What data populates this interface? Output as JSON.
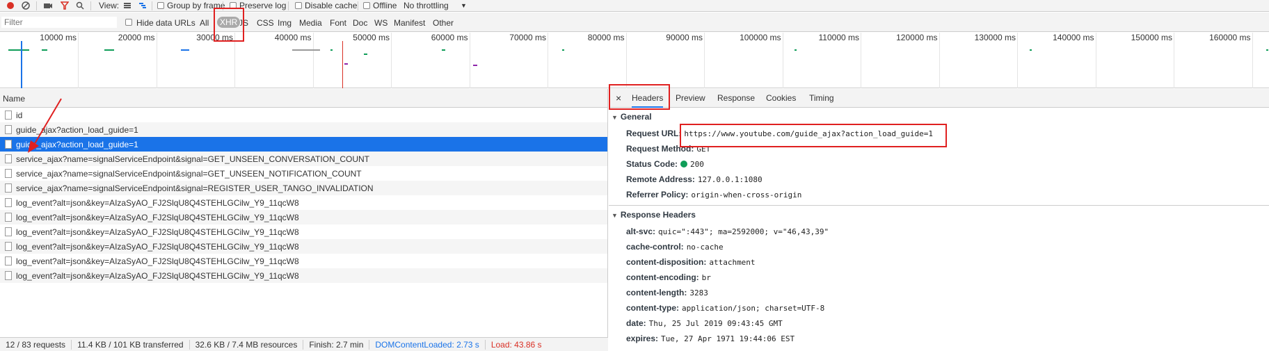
{
  "toolbar": {
    "view_label": "View:",
    "group_by_frame": "Group by frame",
    "preserve_log": "Preserve log",
    "disable_cache": "Disable cache",
    "offline": "Offline",
    "throttling": "No throttling"
  },
  "filterbar": {
    "placeholder": "Filter",
    "hide_data_urls": "Hide data URLs",
    "types": [
      "All",
      "XHR",
      "JS",
      "CSS",
      "Img",
      "Media",
      "Font",
      "Doc",
      "WS",
      "Manifest",
      "Other"
    ],
    "active_type": "XHR"
  },
  "overview": {
    "ticks": [
      "10000 ms",
      "20000 ms",
      "30000 ms",
      "40000 ms",
      "50000 ms",
      "60000 ms",
      "70000 ms",
      "80000 ms",
      "90000 ms",
      "100000 ms",
      "110000 ms",
      "120000 ms",
      "130000 ms",
      "140000 ms",
      "150000 ms",
      "160000 ms"
    ]
  },
  "list": {
    "header": "Name",
    "rows": [
      "id",
      "guide_ajax?action_load_guide=1",
      "guide_ajax?action_load_guide=1",
      "service_ajax?name=signalServiceEndpoint&signal=GET_UNSEEN_CONVERSATION_COUNT",
      "service_ajax?name=signalServiceEndpoint&signal=GET_UNSEEN_NOTIFICATION_COUNT",
      "service_ajax?name=signalServiceEndpoint&signal=REGISTER_USER_TANGO_INVALIDATION",
      "log_event?alt=json&key=AIzaSyAO_FJ2SlqU8Q4STEHLGCilw_Y9_11qcW8",
      "log_event?alt=json&key=AIzaSyAO_FJ2SlqU8Q4STEHLGCilw_Y9_11qcW8",
      "log_event?alt=json&key=AIzaSyAO_FJ2SlqU8Q4STEHLGCilw_Y9_11qcW8",
      "log_event?alt=json&key=AIzaSyAO_FJ2SlqU8Q4STEHLGCilw_Y9_11qcW8",
      "log_event?alt=json&key=AIzaSyAO_FJ2SlqU8Q4STEHLGCilw_Y9_11qcW8",
      "log_event?alt=json&key=AIzaSyAO_FJ2SlqU8Q4STEHLGCilw_Y9_11qcW8"
    ],
    "selected_row": 2
  },
  "status": {
    "requests": "12 / 83 requests",
    "transferred": "11.4 KB / 101 KB transferred",
    "resources": "32.6 KB / 7.4 MB resources",
    "finish": "Finish: 2.7 min",
    "dom_content_loaded": "DOMContentLoaded: 2.73 s",
    "load": "Load: 43.86 s"
  },
  "detail": {
    "tabs": [
      "Headers",
      "Preview",
      "Response",
      "Cookies",
      "Timing"
    ],
    "active_tab": "Headers",
    "general_title": "General",
    "general": [
      {
        "key": "Request URL:",
        "value": "https://www.youtube.com/guide_ajax?action_load_guide=1"
      },
      {
        "key": "Request Method:",
        "value": "GET"
      },
      {
        "key": "Status Code:",
        "value": "200"
      },
      {
        "key": "Remote Address:",
        "value": "127.0.0.1:1080"
      },
      {
        "key": "Referrer Policy:",
        "value": "origin-when-cross-origin"
      }
    ],
    "response_title": "Response Headers",
    "response_headers": [
      {
        "key": "alt-svc:",
        "value": "quic=\":443\"; ma=2592000; v=\"46,43,39\""
      },
      {
        "key": "cache-control:",
        "value": "no-cache"
      },
      {
        "key": "content-disposition:",
        "value": "attachment"
      },
      {
        "key": "content-encoding:",
        "value": "br"
      },
      {
        "key": "content-length:",
        "value": "3283"
      },
      {
        "key": "content-type:",
        "value": "application/json; charset=UTF-8"
      },
      {
        "key": "date:",
        "value": "Thu, 25 Jul 2019 09:43:45 GMT"
      },
      {
        "key": "expires:",
        "value": "Tue, 27 Apr 1971 19:44:06 EST"
      }
    ]
  },
  "colors": {
    "selected": "#1a73e8",
    "annotation": "#e02020",
    "status_ok": "#0f9d58"
  }
}
